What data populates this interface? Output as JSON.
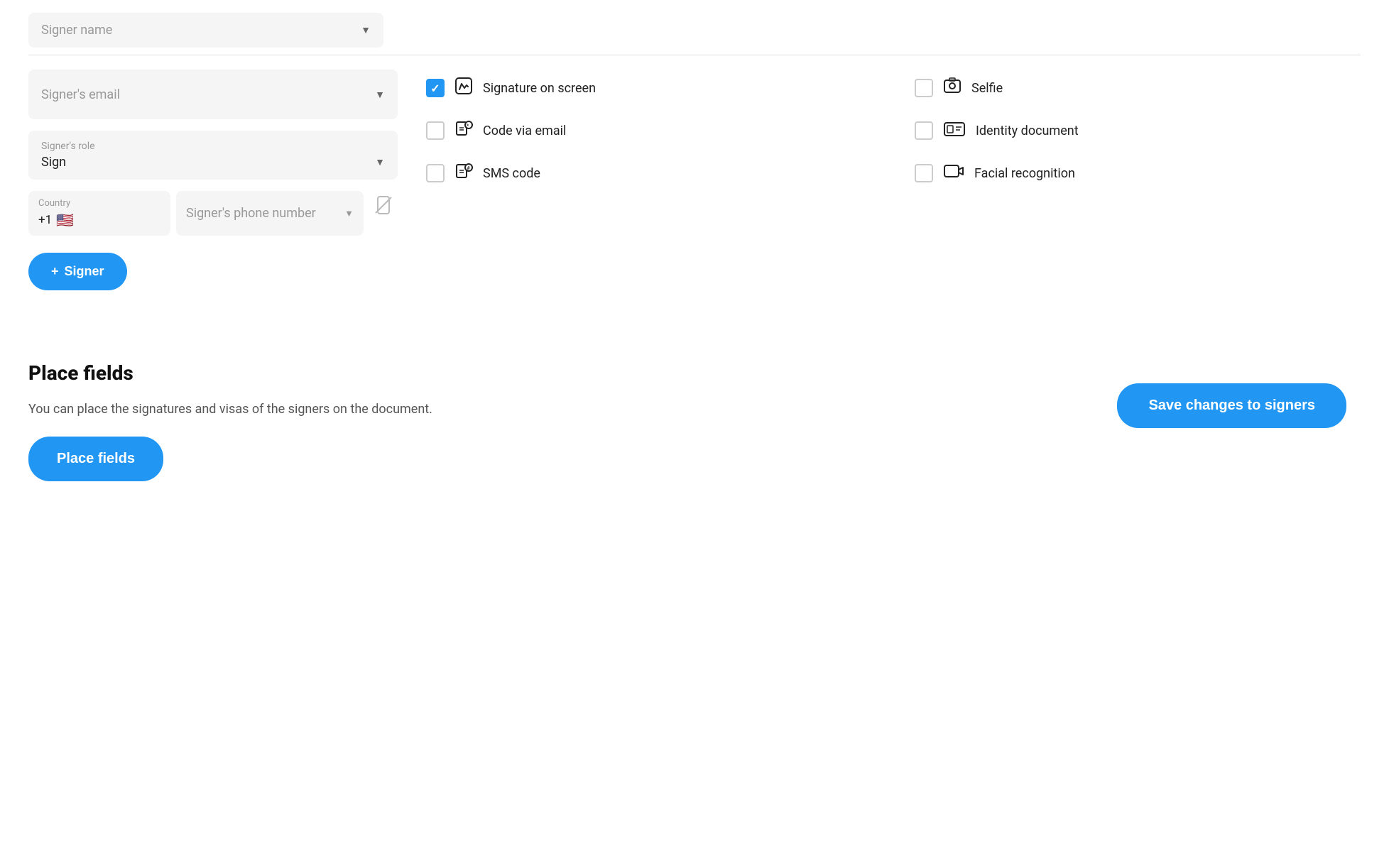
{
  "signerName": {
    "placeholder": "Signer name"
  },
  "signerEmail": {
    "placeholder": "Signer's email"
  },
  "signerRole": {
    "label": "Signer's role",
    "value": "Sign"
  },
  "country": {
    "label": "Country",
    "code": "+1",
    "flag": "🇺🇸"
  },
  "phoneField": {
    "placeholder": "Signer's phone number"
  },
  "checkboxOptions": [
    {
      "id": "signature-on-screen",
      "label": "Signature on screen",
      "checked": true,
      "icon": "✏️"
    },
    {
      "id": "selfie",
      "label": "Selfie",
      "checked": false,
      "icon": "📷"
    },
    {
      "id": "code-via-email",
      "label": "Code via email",
      "checked": false,
      "icon": "📧"
    },
    {
      "id": "identity-document",
      "label": "Identity document",
      "checked": false,
      "icon": "🪪"
    },
    {
      "id": "sms-code",
      "label": "SMS code",
      "checked": false,
      "icon": "💬"
    },
    {
      "id": "facial-recognition",
      "label": "Facial recognition",
      "checked": false,
      "icon": "🎥"
    }
  ],
  "buttons": {
    "addSigner": "+ Signer",
    "saveChanges": "Save changes to signers",
    "placeFields": "Place fields"
  },
  "placeFields": {
    "title": "Place fields",
    "description": "You can place the signatures and visas of the signers on the document."
  }
}
